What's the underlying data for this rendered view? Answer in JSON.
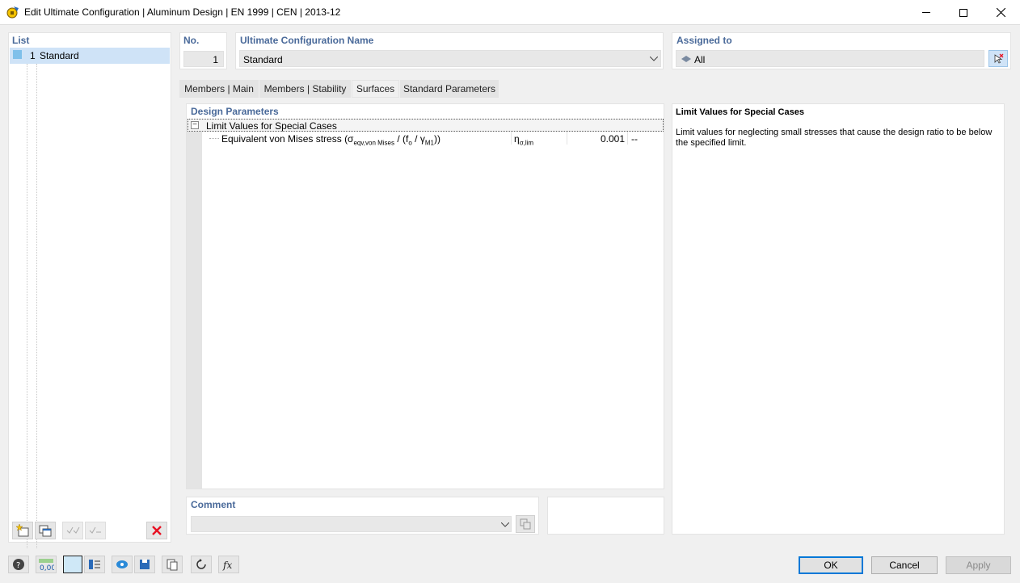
{
  "window": {
    "title": "Edit Ultimate Configuration | Aluminum Design | EN 1999 | CEN | 2013-12",
    "app_icon": "aluminum-design-icon",
    "controls": [
      "minimize-icon",
      "maximize-icon",
      "close-icon"
    ]
  },
  "list": {
    "header": "List",
    "items": [
      {
        "number": "1",
        "name": "Standard",
        "selected": true
      }
    ]
  },
  "config": {
    "no_label": "No.",
    "no_value": "1",
    "name_label": "Ultimate Configuration Name",
    "name_value": "Standard",
    "assigned_label": "Assigned to",
    "assigned_value": "All"
  },
  "tabs": [
    {
      "label": "Members | Main",
      "active": false
    },
    {
      "label": "Members | Stability",
      "active": false
    },
    {
      "label": "Surfaces",
      "active": true
    },
    {
      "label": "Standard Parameters",
      "active": false
    }
  ],
  "design_parameters": {
    "header": "Design Parameters",
    "group": {
      "label": "Limit Values for Special Cases",
      "expanded": true,
      "rows": [
        {
          "label": "Equivalent von Mises stress (σ",
          "label_sub": "eqv,von Mises",
          "label_mid": " / (f",
          "label_sub2": "o",
          "label_mid2": " / γ",
          "label_sub3": "M1",
          "label_end": "))",
          "symbol": "η",
          "symbol_sub": "σ,lim",
          "value": "0.001",
          "unit": "--"
        }
      ]
    }
  },
  "info": {
    "title": "Limit Values for Special Cases",
    "text": "Limit values for neglecting small stresses that cause the design ratio to be below the specified limit."
  },
  "comment": {
    "label": "Comment",
    "value": ""
  },
  "buttons": {
    "ok": "OK",
    "cancel": "Cancel",
    "apply": "Apply"
  },
  "colors": {
    "header_blue": "#4a6a9a",
    "selection": "#cfe3f7",
    "ok_border": "#0078d7",
    "delete_red": "#e81123"
  }
}
